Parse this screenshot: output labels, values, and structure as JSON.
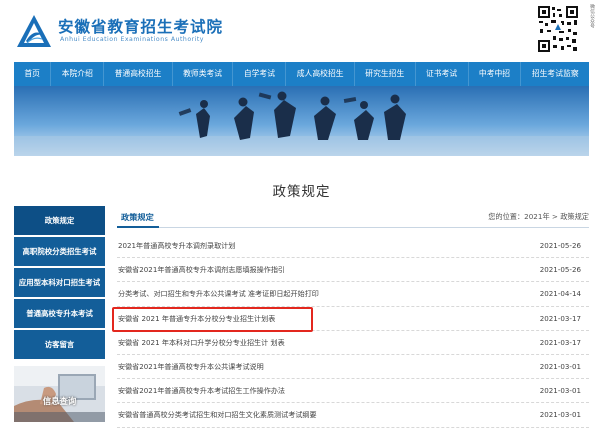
{
  "header": {
    "title_cn": "安徽省教育招生考试院",
    "title_en": "Anhui Education Examinations Authority",
    "qr_side_text": "微信公众号"
  },
  "nav": {
    "items": [
      "首页",
      "本院介绍",
      "普通高校招生",
      "教师类考试",
      "自学考试",
      "成人高校招生",
      "研究生招生",
      "证书考试",
      "中考中招",
      "招生考试监察"
    ]
  },
  "page_title": "政策规定",
  "sidebar": {
    "items": [
      {
        "label": "政策规定",
        "active": true
      },
      {
        "label": "高职院校分类招生考试",
        "active": false
      },
      {
        "label": "应用型本科对口招生考试",
        "active": false
      },
      {
        "label": "普通高校专升本考试",
        "active": false
      },
      {
        "label": "访客留言",
        "active": false
      }
    ],
    "photo_label": "信息查询"
  },
  "content": {
    "tab_label": "政策规定",
    "breadcrumb_prefix": "您的位置：",
    "breadcrumb_year": "2021年",
    "breadcrumb_sep1": " > ",
    "breadcrumb_current": "政策规定"
  },
  "list": [
    {
      "title": "2021年普通高校专升本调剂录取计划",
      "date": "2021-05-26"
    },
    {
      "title": "安徽省2021年普通高校专升本调剂志愿填报操作指引",
      "date": "2021-05-26"
    },
    {
      "title": "分类考试、对口招生和专升本公共课考试 准考证即日起开始打印",
      "date": "2021-04-14"
    },
    {
      "title": "安徽省 2021 年普通专升本分校分专业招生计划表",
      "date": "2021-03-17"
    },
    {
      "title": "安徽省 2021 年本科对口升学分校分专业招生计 划表",
      "date": "2021-03-17"
    },
    {
      "title": "安徽省2021年普通高校专升本公共课考试说明",
      "date": "2021-03-01"
    },
    {
      "title": "安徽省2021年普通高校专升本考试招生工作操作办法",
      "date": "2021-03-01"
    },
    {
      "title": "安徽省普通高校分类考试招生和对口招生文化素质测试考试纲要",
      "date": "2021-03-01"
    }
  ],
  "colors": {
    "nav_bg": "#1c7fc7",
    "sidebar_bg": "#135e99",
    "highlight": "#e3271e"
  }
}
